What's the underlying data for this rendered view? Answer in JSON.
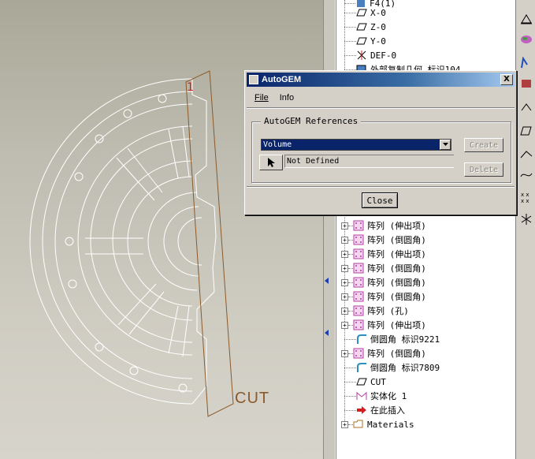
{
  "viewport": {
    "datum_label": "1",
    "cut_label": "CUT"
  },
  "tree": {
    "top_partial": "F4(1)",
    "rows": [
      {
        "label": "X-0",
        "icon": "datum-plane-icon"
      },
      {
        "label": "Z-0",
        "icon": "datum-plane-icon"
      },
      {
        "label": "Y-0",
        "icon": "datum-plane-icon"
      },
      {
        "label": "DEF-0",
        "icon": "csys-icon"
      },
      {
        "label": "外部复制几何 标识104",
        "icon": "copy-geom-icon"
      },
      {
        "label": "阵列 (伸出项)",
        "icon": "pattern-icon",
        "expandable": true
      },
      {
        "label": "阵列 (倒圆角)",
        "icon": "pattern-icon",
        "expandable": true
      },
      {
        "label": "阵列 (伸出项)",
        "icon": "pattern-icon",
        "expandable": true
      },
      {
        "label": "阵列 (倒圆角)",
        "icon": "pattern-icon",
        "expandable": true
      },
      {
        "label": "阵列 (倒圆角)",
        "icon": "pattern-icon",
        "expandable": true
      },
      {
        "label": "阵列 (倒圆角)",
        "icon": "pattern-icon",
        "expandable": true
      },
      {
        "label": "阵列 (孔)",
        "icon": "pattern-icon",
        "expandable": true
      },
      {
        "label": "阵列 (伸出项)",
        "icon": "pattern-icon",
        "expandable": true
      },
      {
        "label": "倒圆角 标识9221",
        "icon": "round-icon"
      },
      {
        "label": "阵列 (倒圆角)",
        "icon": "pattern-icon",
        "expandable": true
      },
      {
        "label": "倒圆角 标识7809",
        "icon": "round-icon"
      },
      {
        "label": "CUT",
        "icon": "datum-plane-icon"
      },
      {
        "label": "实体化 1",
        "icon": "solidify-icon"
      },
      {
        "label": "在此插入",
        "icon": "insert-here-icon"
      },
      {
        "label": "Materials",
        "icon": "materials-icon",
        "expandable": true
      }
    ]
  },
  "dialog": {
    "title": "AutoGEM",
    "close_glyph": "X",
    "menu": {
      "file": "File",
      "info": "Info"
    },
    "group_label": "AutoGEM References",
    "volume_value": "Volume",
    "reference_value": "Not Defined",
    "create_label": "Create",
    "delete_label": "Delete",
    "close_label": "Close"
  },
  "colors": {
    "title_bar": "#0a246a",
    "datum_red": "#d02020",
    "cut_plane": "#8b5a2b"
  }
}
